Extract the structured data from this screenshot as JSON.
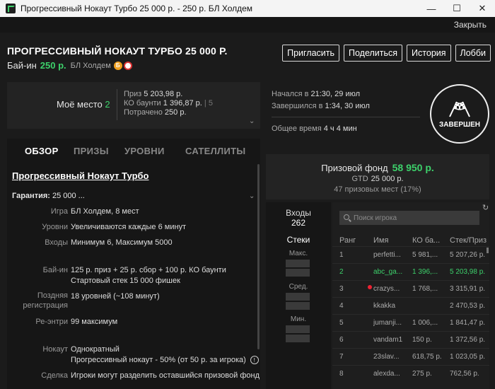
{
  "window": {
    "title": "Прогрессивный Нокаут Турбо 25 000 р. - 250 р. БЛ Холдем",
    "controls": {
      "minimize": "—",
      "maximize": "☐",
      "close": "✕"
    }
  },
  "topbar": {
    "close_label": "Закрыть"
  },
  "header": {
    "title": "ПРОГРЕССИВНЫЙ НОКАУТ ТУРБО 25 000 Р.",
    "buyin_label": "Бай-ин",
    "buyin_value": "250 р.",
    "game": "БЛ Холдем",
    "badge_b": "Б",
    "buttons": {
      "invite": "Пригласить",
      "share": "Поделиться",
      "history": "История",
      "lobby": "Лобби"
    }
  },
  "my_place": {
    "label": "Моё место",
    "value": "2",
    "prize_label": "Приз",
    "prize_value": "5 203,98 р.",
    "ko_label": "КО баунти",
    "ko_value": "1 396,87 р.",
    "ko_sep": "|",
    "ko_count": "5",
    "spent_label": "Потрачено",
    "spent_value": "250 р."
  },
  "tabs": {
    "overview": "ОБЗОР",
    "prizes": "ПРИЗЫ",
    "levels": "УРОВНИ",
    "satellites": "САТЕЛЛИТЫ"
  },
  "overview": {
    "title": "Прогрессивный Нокаут Турбо",
    "guarantee_label": "Гарантия:",
    "guarantee_value": "25 000 ...",
    "rows": {
      "game_label": "Игра",
      "game_value": "БЛ Холдем, 8 мест",
      "levels_label": "Уровни",
      "levels_value": "Увеличиваются каждые 6 минут",
      "entries_label": "Входы",
      "entries_value": "Минимум 6, Максимум 5000",
      "buyin_label": "Бай-ин",
      "buyin_value1": "125 р. приз + 25 р. сбор + 100 р. КО баунти",
      "buyin_value2": "Стартовый стек 15 000 фишек",
      "late_label1": "Поздняя",
      "late_label2": "регистрация",
      "late_value": "18 уровней (~108 минут)",
      "reentry_label": "Ре-энтри",
      "reentry_value": "99 максимум",
      "knockout_label": "Нокаут",
      "knockout_value1": "Однократный",
      "knockout_value2": "Прогрессивный нокаут - 50% (от 50 р. за игрока)",
      "deal_label": "Сделка",
      "deal_value": "Игроки могут разделить оставшийся призовой фонд"
    }
  },
  "times": {
    "started_label": "Начался в",
    "started_value": "21:30, 29 июл",
    "finished_label": "Завершился в",
    "finished_value": "1:34, 30 июл",
    "total_label": "Общее время",
    "total_value": "4 ч 4 мин"
  },
  "status": {
    "label": "ЗАВЕРШЕН"
  },
  "prize_pool": {
    "label": "Призовой фонд",
    "value": "58 950 р.",
    "gtd_label": "GTD",
    "gtd_value": "25 000 р.",
    "places": "47 призовых мест (17%)"
  },
  "stats": {
    "entries_label": "Входы",
    "entries_value": "262",
    "stacks_label": "Стеки",
    "max_label": "Макс.",
    "avg_label": "Сред.",
    "min_label": "Мин."
  },
  "players": {
    "search_placeholder": "Поиск игрока",
    "columns": {
      "rank": "Ранг",
      "name": "Имя",
      "ko": "КО ба...",
      "stack": "Стек/Приз"
    },
    "rows": [
      {
        "rank": "1",
        "name": "perfetti...",
        "ko": "5 981,...",
        "stack": "5 207,26 р."
      },
      {
        "rank": "2",
        "name": "abc_ga...",
        "ko": "1 396,...",
        "stack": "5 203,98 р."
      },
      {
        "rank": "3",
        "name": "crazys...",
        "ko": "1 768,...",
        "stack": "3 315,91 р."
      },
      {
        "rank": "4",
        "name": "kkakka",
        "ko": "",
        "stack": "2 470,53 р."
      },
      {
        "rank": "5",
        "name": "jumanji...",
        "ko": "1 006,...",
        "stack": "1 841,47 р."
      },
      {
        "rank": "6",
        "name": "vandam1",
        "ko": "150 р.",
        "stack": "1 372,56 р."
      },
      {
        "rank": "7",
        "name": "23slav...",
        "ko": "618,75 р.",
        "stack": "1 023,05 р."
      },
      {
        "rank": "8",
        "name": "alexda...",
        "ko": "275 р.",
        "stack": "762,56 р."
      }
    ]
  },
  "colors": {
    "accent": "#3dd16b",
    "background": "#1b1b1b",
    "panel": "#232323",
    "alert": "#e22233"
  }
}
